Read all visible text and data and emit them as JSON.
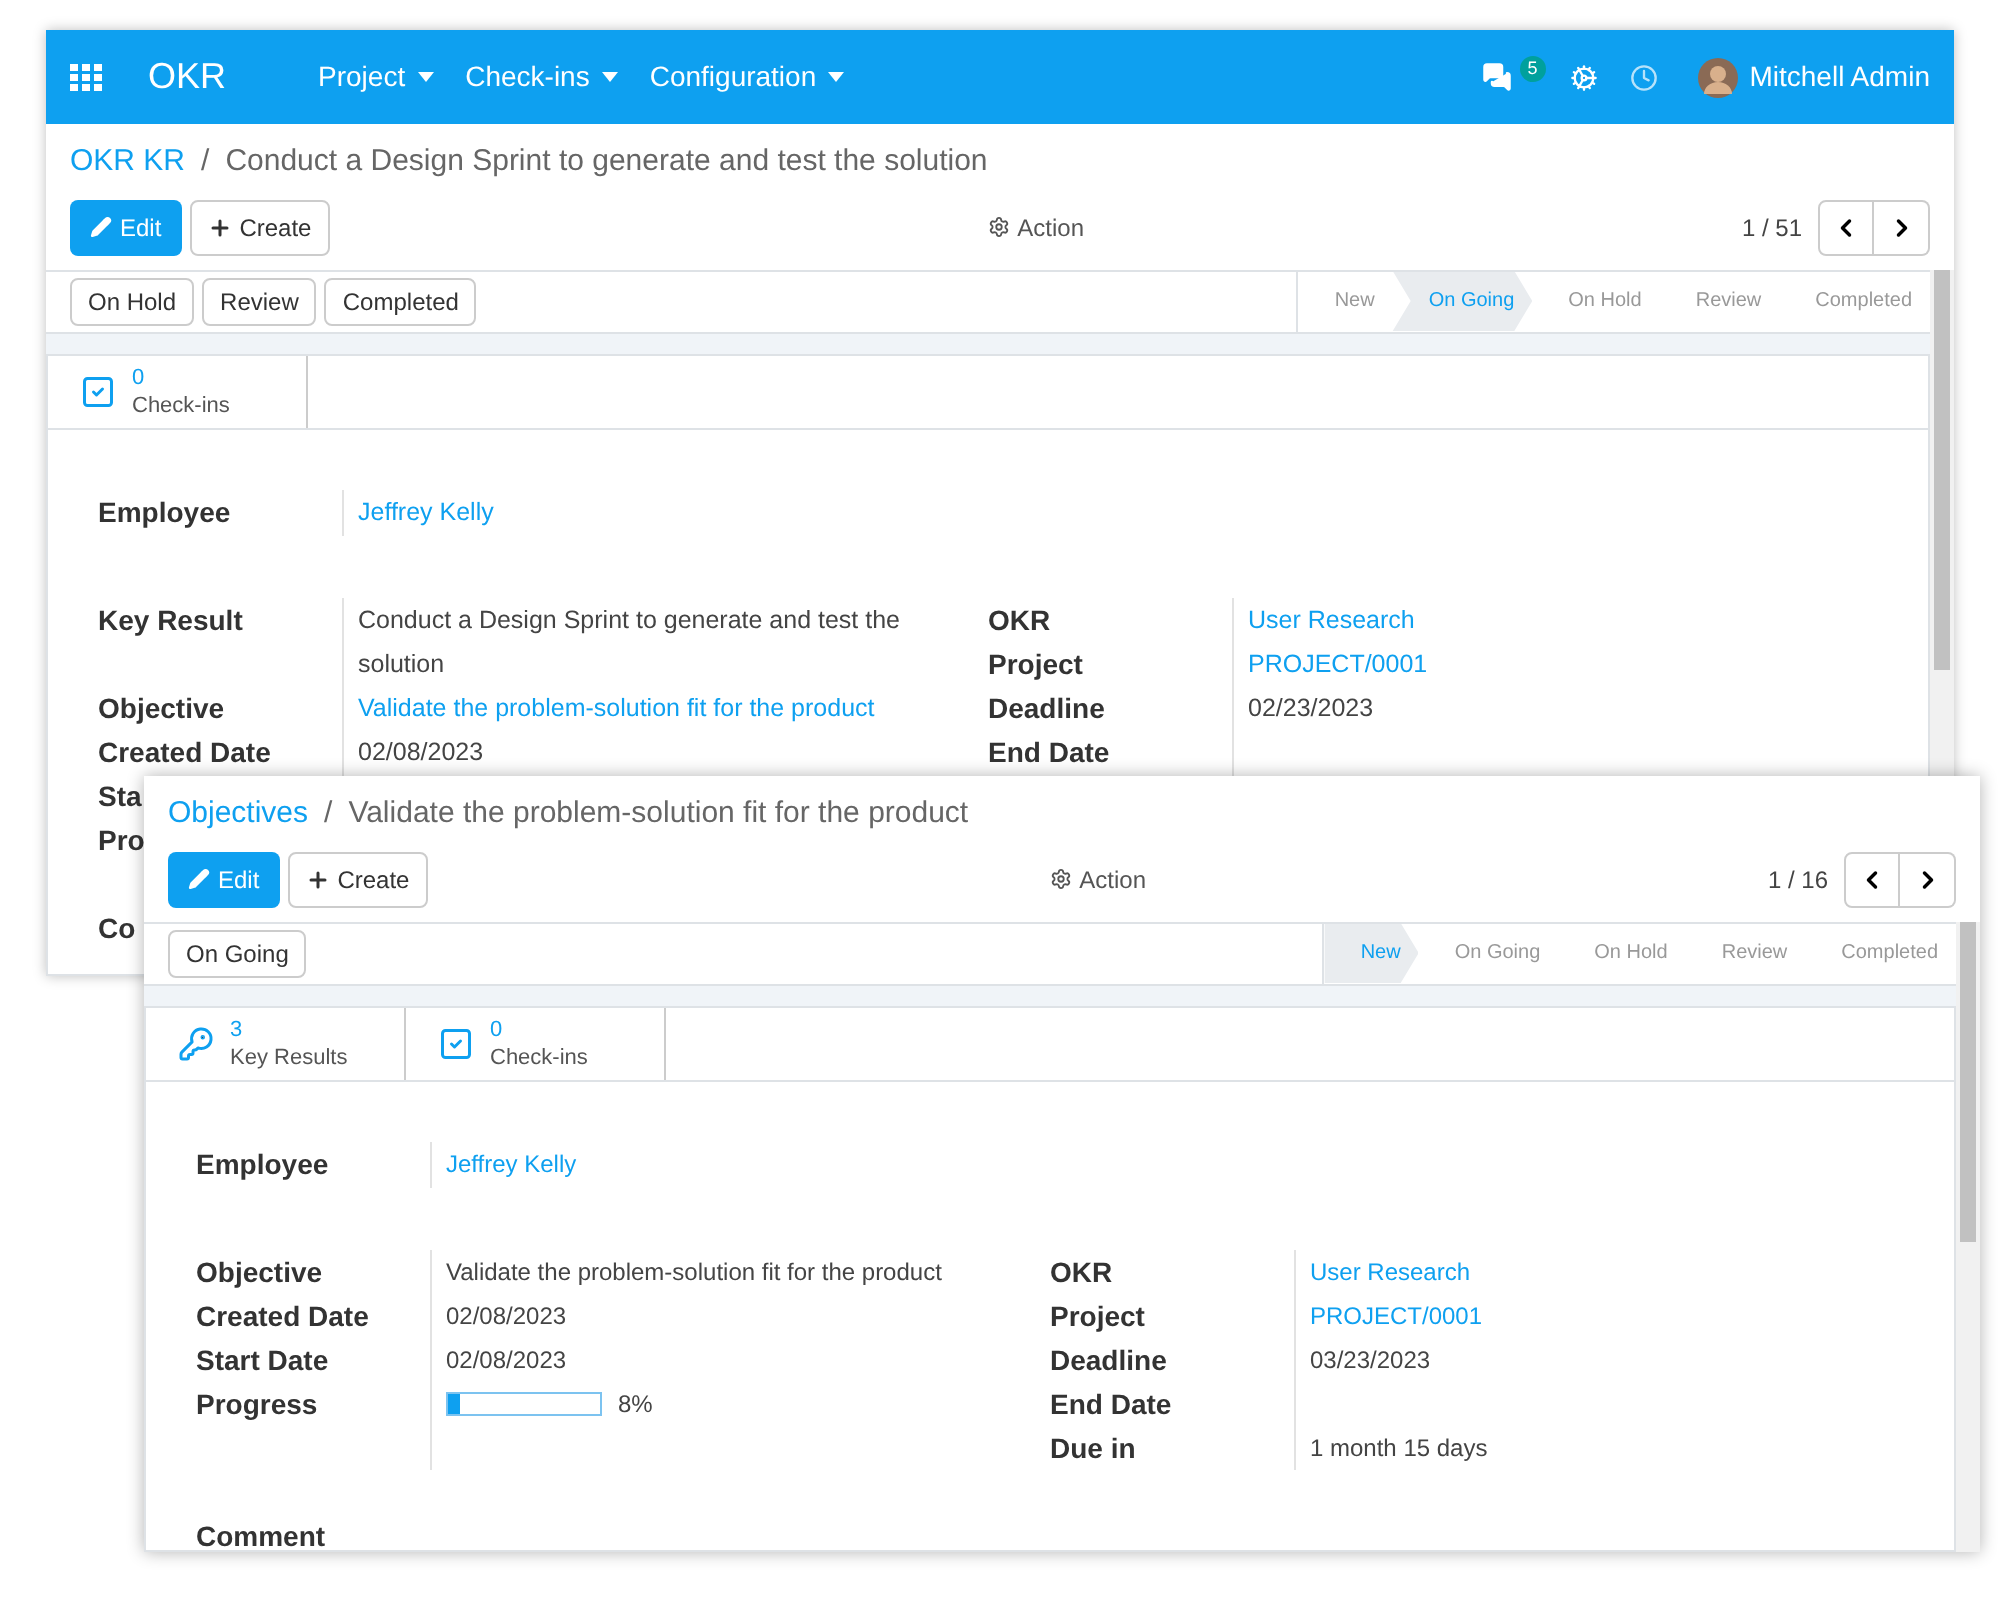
{
  "back_window": {
    "navbar": {
      "app_name": "OKR",
      "menus": [
        "Project",
        "Check-ins",
        "Configuration"
      ],
      "message_count": "5",
      "user": "Mitchell Admin"
    },
    "breadcrumb": {
      "parent": "OKR KR",
      "separator": "/",
      "current": "Conduct a Design Sprint to generate and test the solution"
    },
    "edit": "Edit",
    "create": "Create",
    "action": "Action",
    "pager": "1 / 51",
    "status_buttons": [
      "On Hold",
      "Review",
      "Completed"
    ],
    "stages": [
      {
        "label": "New",
        "selected": false
      },
      {
        "label": "On Going",
        "selected": true
      },
      {
        "label": "On Hold",
        "selected": false
      },
      {
        "label": "Review",
        "selected": false
      },
      {
        "label": "Completed",
        "selected": false
      }
    ],
    "smart_buttons": [
      {
        "kind": "checkins",
        "count": "0",
        "label": "Check-ins"
      }
    ],
    "employee": {
      "label": "Employee",
      "value": "Jeffrey Kelly"
    },
    "left_fields": [
      {
        "label": "Key Result",
        "value": "Conduct a Design Sprint to generate and test the solution",
        "kind": "text"
      },
      {
        "label": "Objective",
        "value": "Validate the problem-solution fit for the product",
        "kind": "link"
      },
      {
        "label": "Created Date",
        "value": "02/08/2023",
        "kind": "text"
      },
      {
        "label": "Sta",
        "kind": "text"
      },
      {
        "label": "Pro",
        "kind": "text"
      }
    ],
    "right_fields": [
      {
        "label": "OKR",
        "value": "User Research",
        "kind": "link"
      },
      {
        "label": "Project",
        "value": "PROJECT/0001",
        "kind": "link"
      },
      {
        "label": "Deadline",
        "value": "02/23/2023",
        "kind": "text"
      },
      {
        "label": "End Date",
        "kind": "text"
      }
    ],
    "comment_label": "Co"
  },
  "front_window": {
    "breadcrumb": {
      "parent": "Objectives",
      "separator": "/",
      "current": "Validate the problem-solution fit for the product"
    },
    "edit": "Edit",
    "create": "Create",
    "action": "Action",
    "pager": "1 / 16",
    "status_buttons": [
      "On Going"
    ],
    "stages": [
      {
        "label": "New",
        "selected": true
      },
      {
        "label": "On Going",
        "selected": false
      },
      {
        "label": "On Hold",
        "selected": false
      },
      {
        "label": "Review",
        "selected": false
      },
      {
        "label": "Completed",
        "selected": false
      }
    ],
    "smart_buttons": [
      {
        "kind": "key_results",
        "count": "3",
        "label": "Key Results"
      },
      {
        "kind": "checkins",
        "count": "0",
        "label": "Check-ins"
      }
    ],
    "employee": {
      "label": "Employee",
      "value": "Jeffrey Kelly"
    },
    "left_fields": [
      {
        "label": "Objective",
        "value": "Validate the problem-solution fit for the product",
        "kind": "text"
      },
      {
        "label": "Created Date",
        "value": "02/08/2023",
        "kind": "text"
      },
      {
        "label": "Start Date",
        "value": "02/08/2023",
        "kind": "text"
      },
      {
        "label": "Progress",
        "kind": "progress",
        "level": 0.08,
        "reading": "8%"
      }
    ],
    "right_fields": [
      {
        "label": "OKR",
        "value": "User Research",
        "kind": "link"
      },
      {
        "label": "Project",
        "value": "PROJECT/0001",
        "kind": "link"
      },
      {
        "label": "Deadline",
        "value": "03/23/2023",
        "kind": "text"
      },
      {
        "label": "End Date",
        "kind": "text"
      },
      {
        "label": "Due in",
        "value": "1 month 15 days",
        "kind": "text"
      }
    ],
    "comment_label": "Comment"
  }
}
